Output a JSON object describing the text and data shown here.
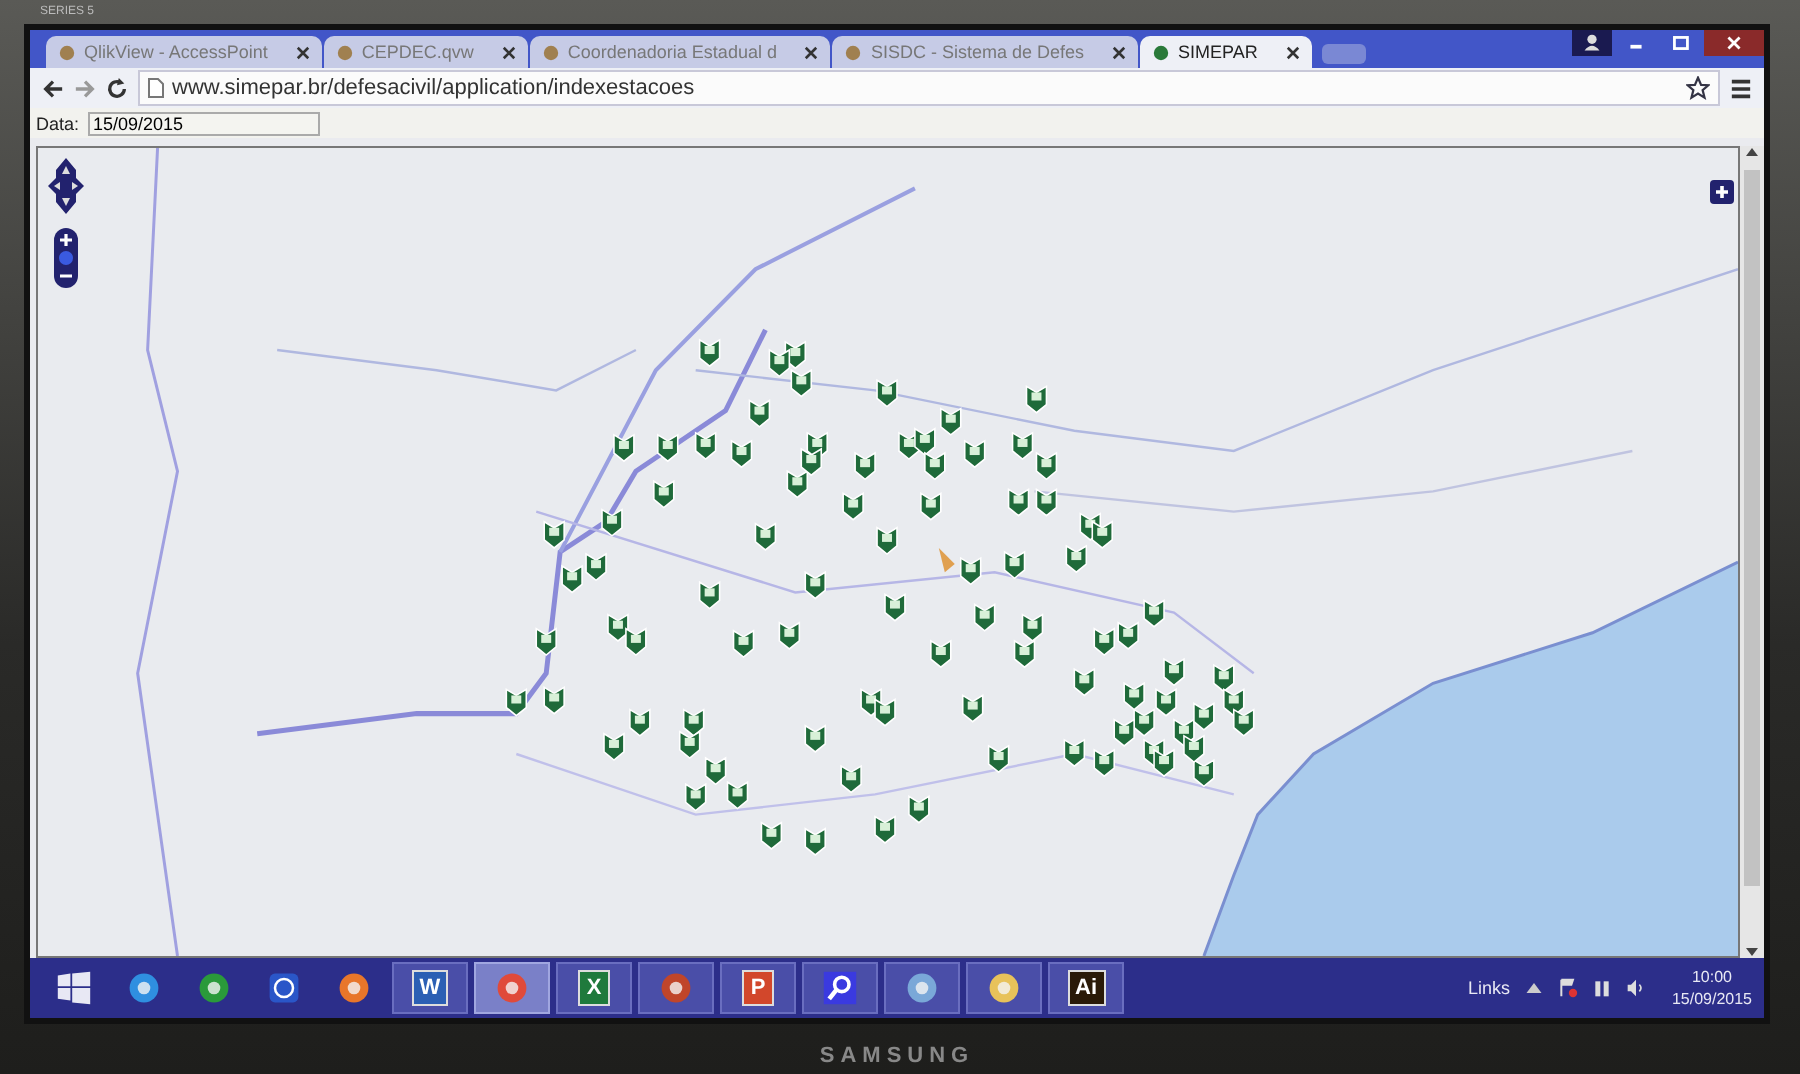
{
  "monitor": {
    "series_label": "SERIES 5",
    "brand": "SAMSUNG"
  },
  "tabs": [
    {
      "title": "QlikView - AccessPoint",
      "selected": false
    },
    {
      "title": "CEPDEC.qvw",
      "selected": false
    },
    {
      "title": "Coordenadoria Estadual d",
      "selected": false
    },
    {
      "title": "SISDC - Sistema de Defes",
      "selected": false
    },
    {
      "title": "SIMEPAR",
      "selected": true
    }
  ],
  "address_bar": {
    "url": "www.simepar.br/defesacivil/application/indexestacoes"
  },
  "date_filter": {
    "label": "Data:",
    "value": "15/09/2015"
  },
  "taskbar": {
    "apps": [
      {
        "kind": "start",
        "running": false,
        "selected": false
      },
      {
        "kind": "ie",
        "running": false,
        "selected": false
      },
      {
        "kind": "store",
        "running": false,
        "selected": false
      },
      {
        "kind": "help",
        "running": false,
        "selected": false
      },
      {
        "kind": "firefox",
        "running": false,
        "selected": false
      },
      {
        "kind": "word",
        "label": "W",
        "running": true,
        "selected": false
      },
      {
        "kind": "chrome",
        "running": true,
        "selected": true
      },
      {
        "kind": "excel",
        "label": "X",
        "running": true,
        "selected": false
      },
      {
        "kind": "bitdefender",
        "running": true,
        "selected": false
      },
      {
        "kind": "powerpoint",
        "label": "P",
        "running": true,
        "selected": false
      },
      {
        "kind": "search",
        "running": true,
        "selected": false
      },
      {
        "kind": "paint",
        "running": true,
        "selected": false
      },
      {
        "kind": "explorer",
        "running": true,
        "selected": false
      },
      {
        "kind": "illustrator",
        "label": "Ai",
        "running": true,
        "selected": false
      }
    ],
    "tray_label": "Links",
    "time": "10:00",
    "date": "15/09/2015"
  }
}
